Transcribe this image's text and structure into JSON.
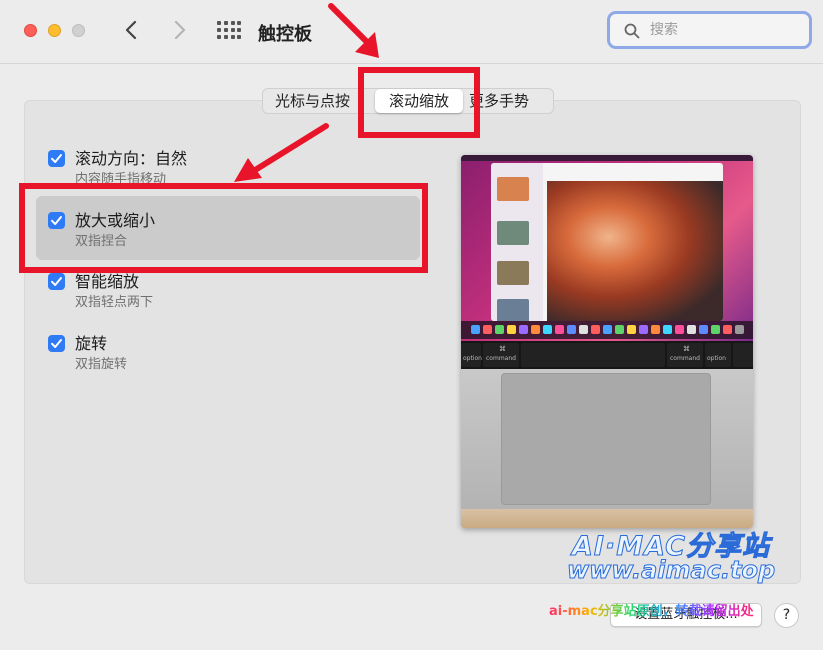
{
  "window": {
    "title": "触控板"
  },
  "search": {
    "placeholder": "搜索",
    "value": ""
  },
  "tabs": [
    {
      "label": "光标与点按",
      "active": false
    },
    {
      "label": "滚动缩放",
      "active": true
    },
    {
      "label": "更多手势",
      "active": false
    }
  ],
  "options": [
    {
      "title": "滚动方向：自然",
      "subtitle": "内容随手指移动",
      "checked": true
    },
    {
      "title": "放大或缩小",
      "subtitle": "双指捏合",
      "checked": true
    },
    {
      "title": "智能缩放",
      "subtitle": "双指轻点两下",
      "checked": true
    },
    {
      "title": "旋转",
      "subtitle": "双指旋转",
      "checked": true
    }
  ],
  "footer": {
    "setup_bluetooth_label": "设置蓝牙触控板...",
    "help_label": "?"
  },
  "preview": {
    "keys": [
      "option",
      "command",
      "command",
      "option"
    ],
    "key_symbols": [
      "⌘",
      "⌘"
    ]
  },
  "watermarks": {
    "brand": "AI·MAC分享站",
    "url": "www.aimac.top",
    "banner": "ai-mac分享站原创，转载请留出处"
  },
  "colors": {
    "accent": "#2f7bf6",
    "annotation_red": "#e8152a",
    "search_focus": "#8ea8e8"
  }
}
